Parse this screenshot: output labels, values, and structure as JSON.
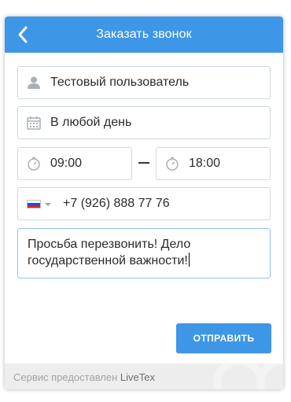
{
  "header": {
    "title": "Заказать звонок",
    "back_icon": "chevron-left-icon",
    "color": "#3d96e6"
  },
  "form": {
    "name": {
      "value": "Тестовый пользователь",
      "icon": "user-icon"
    },
    "day": {
      "value": "В любой день",
      "icon": "calendar-icon"
    },
    "time_from": {
      "value": "09:00",
      "icon": "stopwatch-icon"
    },
    "time_to": {
      "value": "18:00",
      "icon": "stopwatch-icon"
    },
    "phone": {
      "value": "+7 (926) 888 77 76",
      "country": "russia-flag-icon"
    },
    "message": {
      "value": "Просьба перезвонить! Дело государственной важности!"
    }
  },
  "submit": {
    "label": "ОТПРАВИТЬ",
    "color": "#3d96e6"
  },
  "footer": {
    "text": "Сервис предоставлен ",
    "brand": "LiveTex"
  }
}
